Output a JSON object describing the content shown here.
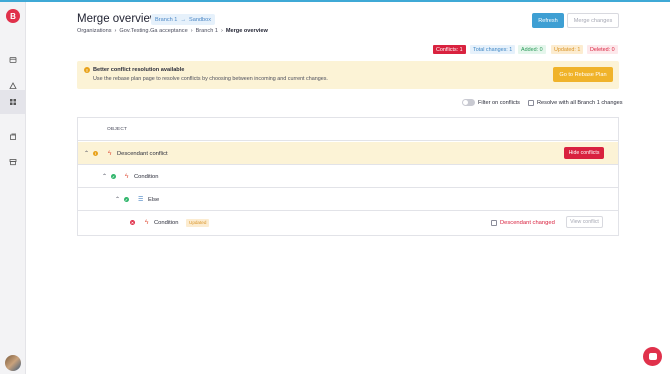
{
  "colors": {
    "accent": "#3e9fd3",
    "danger": "#d9223f",
    "warning": "#f0b32a",
    "success": "#2fb56a"
  },
  "sidebar": {
    "logo_letter": "B",
    "items": [
      {
        "icon": "repository-icon"
      },
      {
        "icon": "diagram-icon"
      },
      {
        "icon": "grid-icon",
        "active": true
      },
      {
        "icon": "documents-icon"
      },
      {
        "icon": "archive-icon"
      }
    ]
  },
  "header": {
    "title": "Merge overview",
    "source_branch": "Branch 1",
    "target_branch": "Sandbox",
    "refresh_label": "Refresh",
    "merge_label": "Merge changes"
  },
  "breadcrumb": [
    "Organizations",
    "Gov.Testing.Ga acceptance",
    "Branch 1",
    "Merge overview"
  ],
  "stats": {
    "conflicts": "Conflicts: 1",
    "total": "Total changes: 1",
    "added": "Added: 0",
    "updated": "Updated: 1",
    "deleted": "Deleted: 0"
  },
  "banner": {
    "title": "Better conflict resolution available",
    "text": "Use the rebase plan page to resolve conflicts by choosing between incoming and current changes.",
    "button": "Go to Rebase Plan"
  },
  "filters": {
    "filter_label": "Filter on conflicts",
    "resolve_label": "Resolve with all Branch 1 changes"
  },
  "table": {
    "header": "OBJECT",
    "rows": [
      {
        "label": "Descendant conflict",
        "action": "Hide conflicts"
      },
      {
        "label": "Condition"
      },
      {
        "label": "Else"
      },
      {
        "label": "Condition",
        "badge": "Updated",
        "status": "Descendant changed",
        "action": "View conflict"
      }
    ]
  }
}
